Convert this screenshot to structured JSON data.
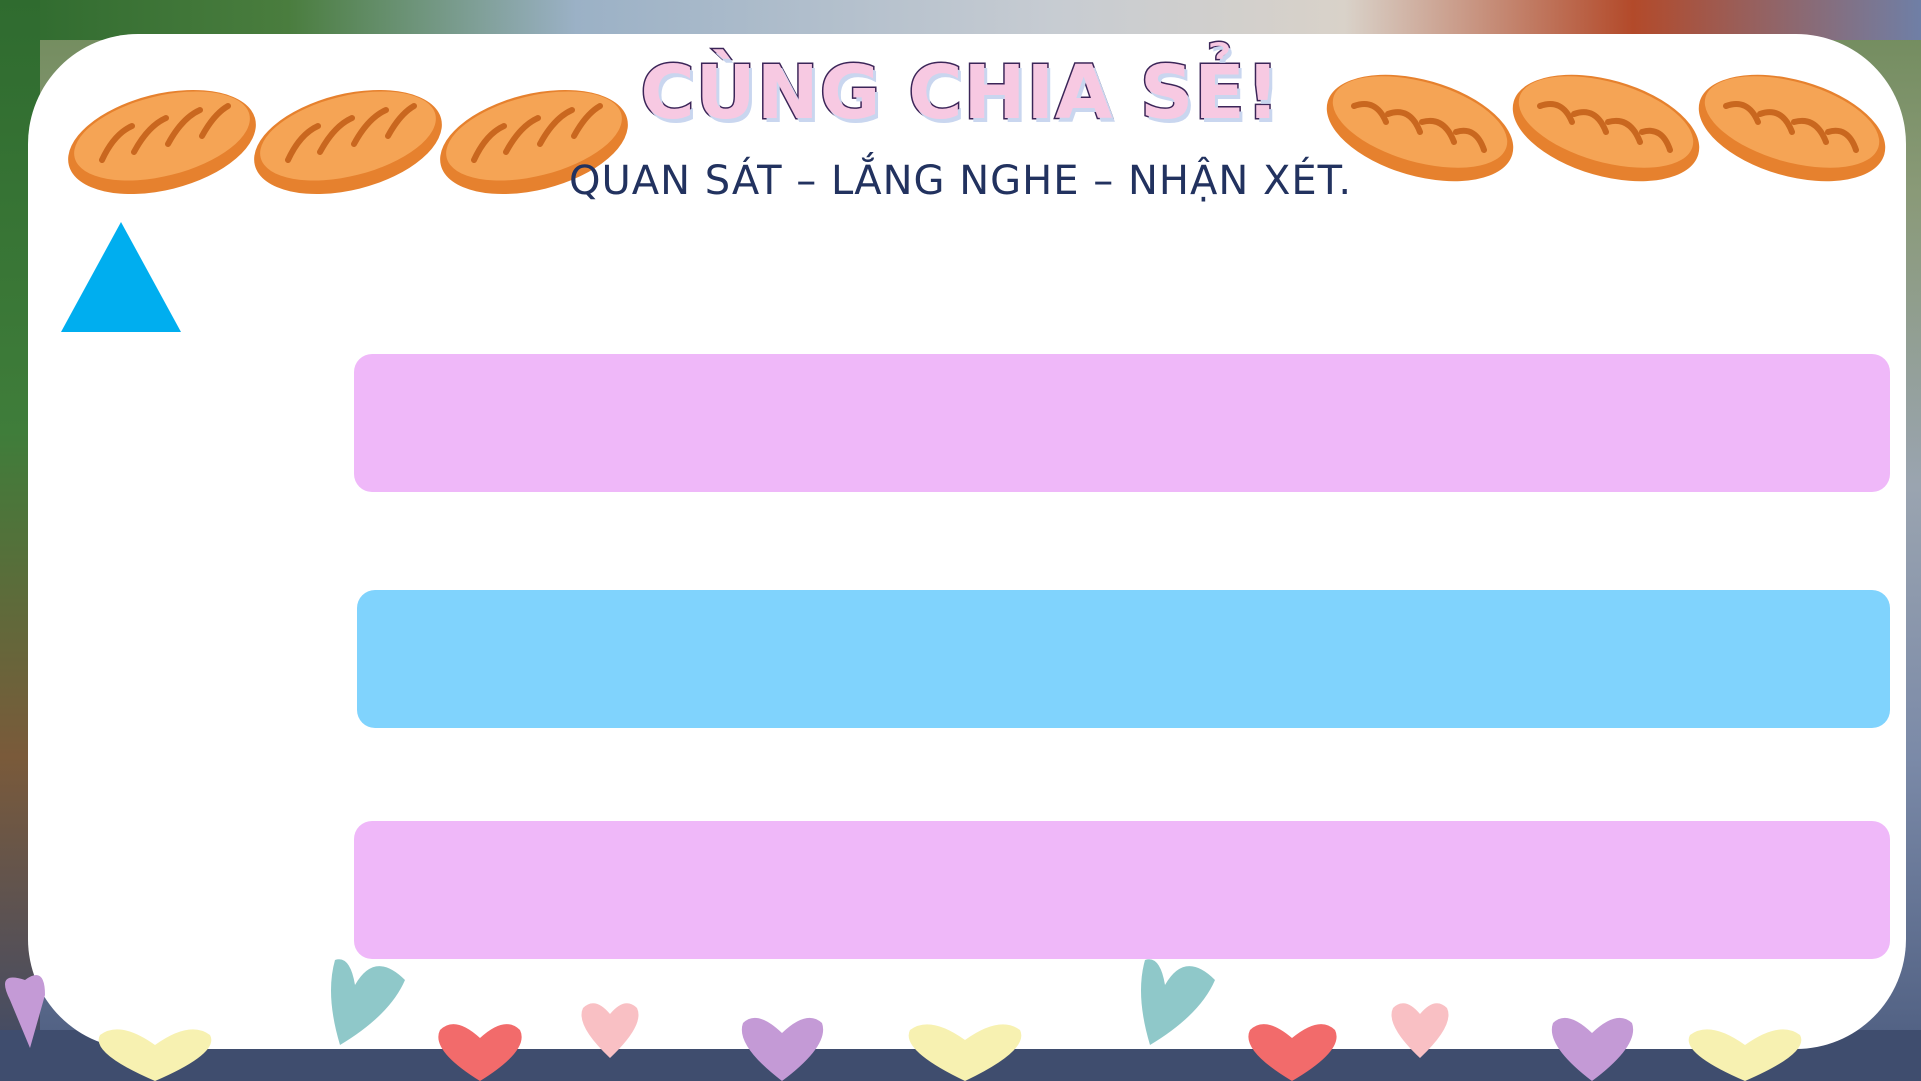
{
  "header": {
    "title": "CÙNG CHIA SẺ!",
    "subtitle": "QUAN SÁT – LẮNG NGHE – NHẬN XÉT."
  },
  "decorations": {
    "bread_icon": "bread-icon",
    "bread_count_left": 3,
    "bread_count_right": 3,
    "triangle_icon": "triangle-icon",
    "heart_icon": "heart-icon"
  },
  "bars": [
    {
      "color": "#efb8f9",
      "text": ""
    },
    {
      "color": "#80d3fd",
      "text": ""
    },
    {
      "color": "#efb8f9",
      "text": ""
    }
  ],
  "colors": {
    "title_fill": "#f7c9e2",
    "subtitle": "#22325f",
    "triangle": "#00aeef",
    "bread": "#f09a4a",
    "frame_dash": "#1f2e63"
  }
}
